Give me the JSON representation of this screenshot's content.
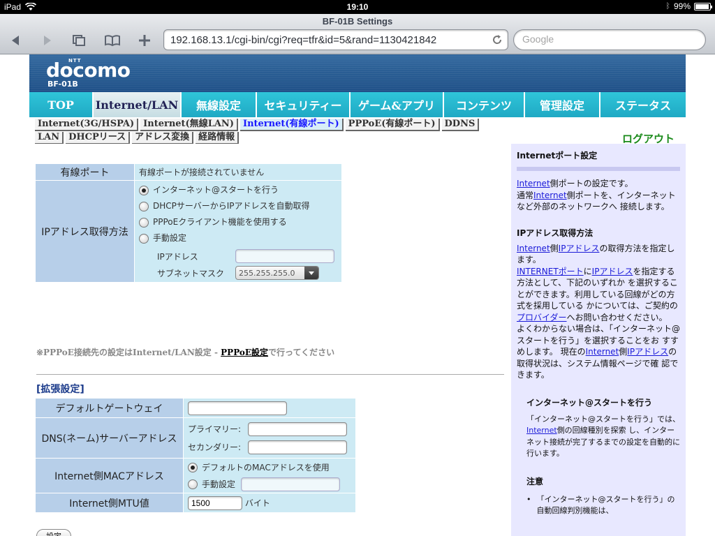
{
  "status_bar": {
    "device": "iPad",
    "time": "19:10",
    "battery": "99%"
  },
  "browser": {
    "title": "BF-01B Settings",
    "url": "192.168.13.1/cgi-bin/cgi?req=tfr&id=5&rand=1130421842",
    "search_placeholder": "Google"
  },
  "header": {
    "ntt": "NTT",
    "logo": "docomo",
    "model": "BF-01B"
  },
  "main_nav": [
    {
      "label": "TOP"
    },
    {
      "label": "Internet/LAN"
    },
    {
      "label": "無線設定"
    },
    {
      "label": "セキュリティー"
    },
    {
      "label": "ゲーム&アプリ"
    },
    {
      "label": "コンテンツ"
    },
    {
      "label": "管理設定"
    },
    {
      "label": "ステータス"
    }
  ],
  "sub_nav": {
    "row1": [
      "Internet(3G/HSPA)",
      "Internet(無線LAN)",
      "Internet(有線ポート)",
      "PPPoE(有線ポート)",
      "DDNS"
    ],
    "row2": [
      "LAN",
      "DHCPリース",
      "アドレス変換",
      "経路情報"
    ],
    "logout": "ログアウト"
  },
  "wired_port": {
    "label": "有線ポート",
    "value": "有線ポートが接続されていません"
  },
  "ip_method": {
    "label": "IPアドレス取得方法",
    "options": [
      "インターネット@スタートを行う",
      "DHCPサーバーからIPアドレスを自動取得",
      "PPPoEクライアント機能を使用する",
      "手動設定"
    ],
    "ip_label": "IPアドレス",
    "ip_value": "",
    "subnet_label": "サブネットマスク",
    "subnet_value": "255.255.255.0"
  },
  "pppoe_note": {
    "prefix": "※PPPoE接続先の設定はInternet/LAN設定 - ",
    "link": "PPPoE設定",
    "suffix": "で行ってください"
  },
  "extended": {
    "heading": "[拡張設定]",
    "gateway_label": "デフォルトゲートウェイ",
    "gateway_value": "",
    "dns_label": "DNS(ネーム)サーバーアドレス",
    "dns_primary_label": "プライマリー:",
    "dns_secondary_label": "セカンダリー:",
    "mac_label": "Internet側MACアドレス",
    "mac_default": "デフォルトのMACアドレスを使用",
    "mac_manual": "手動設定",
    "mtu_label": "Internet側MTU値",
    "mtu_value": "1500",
    "mtu_unit": "バイト"
  },
  "submit_label": "設定",
  "help": {
    "title": "Internetポート設定",
    "p1_link1": "Internet",
    "p1_t1": "側ポートの設定です。",
    "p1_t2": "通常",
    "p1_link2": "Internet",
    "p1_t3": "側ポートを、インターネットなど外部のネットワークへ 接続します。",
    "h2": "IPアドレス取得方法",
    "p2_link1": "Internet",
    "p2_t1": "側",
    "p2_link2": "IPアドレス",
    "p2_t2": "の取得方法を指定します。",
    "p2_link3": "INTERNETポート",
    "p2_t3": "に",
    "p2_link4": "IPアドレス",
    "p2_t4": "を指定する方法として、下記のいずれか を選択することができます。利用している回線がどの方式を採用している かについては、ご契約の",
    "p2_link5": "プロバイダー",
    "p2_t5": "へお問い合わせください。",
    "p2_t6": "よくわからない場合は、「インターネット@スタートを行う」を選択することをお すすめします。 現在の",
    "p2_link6": "Internet",
    "p2_t7": "側",
    "p2_link7": "IPアドレス",
    "p2_t8": "の取得状況は、システム情報ページで確 認できます。",
    "h3": "インターネット@スタートを行う",
    "p3_t1": "「インターネット@スタートを行う」では、",
    "p3_link1": "Internet",
    "p3_t2": "側の回線種別を探索 し、インターネット接続が完了するまでの設定を自動的に行います。",
    "h4": "注意",
    "p4": "「インターネット@スタートを行う」の自動回線判別機能は、"
  }
}
